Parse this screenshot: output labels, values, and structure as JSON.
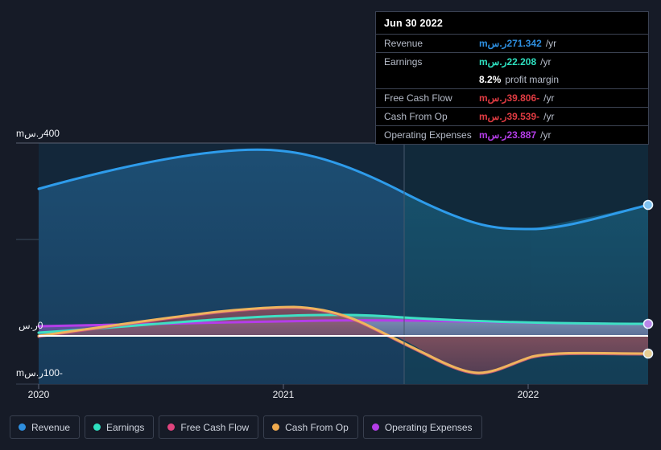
{
  "tooltip": {
    "date": "Jun 30 2022",
    "rows": [
      {
        "label": "Revenue",
        "value": "271.342ر.سm",
        "unit": "/yr",
        "color": "#2e8fe0"
      },
      {
        "label": "Earnings",
        "value": "22.208ر.سm",
        "unit": "/yr",
        "color": "#2ee0c0"
      },
      {
        "label": "",
        "value": "8.2%",
        "unit": "profit margin",
        "color": "#ffffff"
      },
      {
        "label": "Free Cash Flow",
        "value": "-39.806ر.سm",
        "unit": "/yr",
        "color": "#e03b42"
      },
      {
        "label": "Cash From Op",
        "value": "-39.539ر.سm",
        "unit": "/yr",
        "color": "#e03b42"
      },
      {
        "label": "Operating Expenses",
        "value": "23.887ر.سm",
        "unit": "/yr",
        "color": "#b43de8"
      }
    ]
  },
  "legend": {
    "items": [
      {
        "label": "Revenue",
        "color": "#2e8fe0"
      },
      {
        "label": "Earnings",
        "color": "#2ee0c0"
      },
      {
        "label": "Free Cash Flow",
        "color": "#e0447e"
      },
      {
        "label": "Cash From Op",
        "color": "#efaa4e"
      },
      {
        "label": "Operating Expenses",
        "color": "#b43de8"
      }
    ]
  },
  "axes": {
    "y_ticks": [
      {
        "label": "400ر.سm"
      },
      {
        "label": "0ر.س"
      },
      {
        "label": "-100ر.سm"
      }
    ],
    "x_ticks": [
      {
        "label": "2020"
      },
      {
        "label": "2021"
      },
      {
        "label": "2022"
      }
    ]
  },
  "chart_data": {
    "type": "area",
    "title": "",
    "xlabel": "",
    "ylabel": "ر.سm",
    "ylim": [
      -100,
      400
    ],
    "grid": true,
    "legend_position": "bottom",
    "x_tick_labels": [
      "2020",
      "2021",
      "2022"
    ],
    "y_tick_labels": [
      "400ر.سm",
      "0ر.س",
      "-100ر.سm"
    ],
    "forecast_divider_x": "2021.5",
    "x": [
      "2020.0",
      "2020.25",
      "2020.5",
      "2020.75",
      "2021.0",
      "2021.25",
      "2021.5",
      "2021.75",
      "2022.0",
      "2022.25",
      "2022.5"
    ],
    "series": [
      {
        "name": "Revenue",
        "color": "#2e8fe0",
        "values": [
          305,
          330,
          355,
          375,
          388,
          380,
          355,
          310,
          275,
          272,
          271.342
        ],
        "end_value": 271.342
      },
      {
        "name": "Earnings",
        "color": "#2ee0c0",
        "values": [
          4,
          10,
          16,
          22,
          27,
          29,
          28,
          26,
          24,
          23,
          22.208
        ],
        "end_value": 22.208
      },
      {
        "name": "Free Cash Flow",
        "color": "#e0447e",
        "values": [
          -2,
          12,
          33,
          52,
          62,
          58,
          28,
          -20,
          -52,
          -44,
          -39.806
        ],
        "end_value": -39.806
      },
      {
        "name": "Cash From Op",
        "color": "#efaa4e",
        "values": [
          -2,
          13,
          34,
          53,
          63,
          59,
          29,
          -19,
          -51,
          -43,
          -39.539
        ],
        "end_value": -39.539
      },
      {
        "name": "Operating Expenses",
        "color": "#b43de8",
        "values": [
          14,
          15,
          16,
          17,
          18,
          19,
          20,
          21,
          22,
          23,
          23.887
        ],
        "end_value": 23.887
      }
    ]
  }
}
